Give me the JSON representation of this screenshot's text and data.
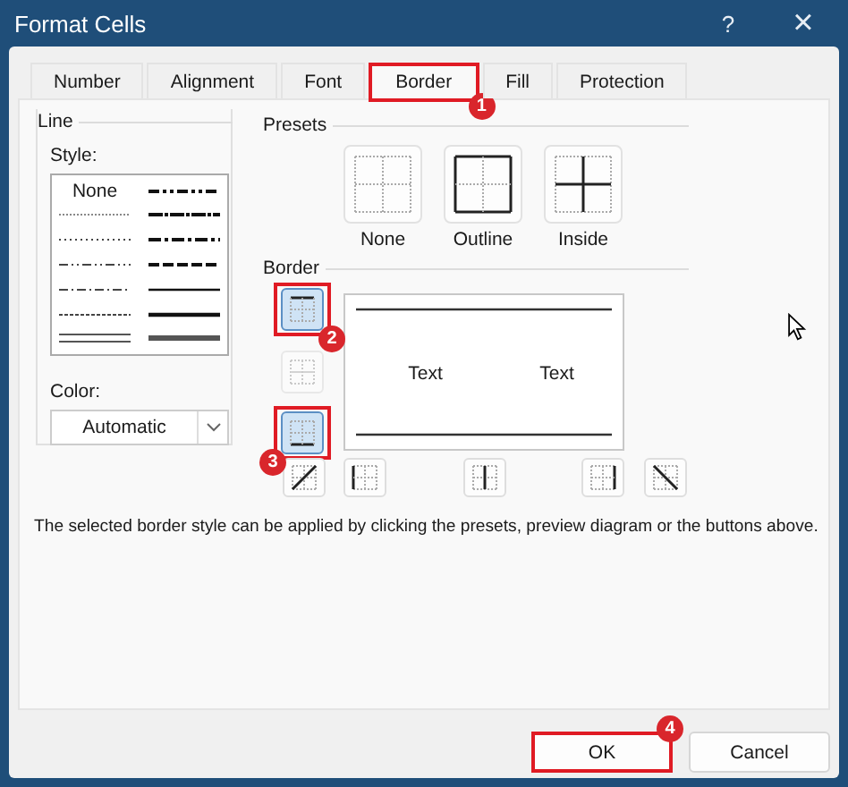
{
  "window": {
    "title": "Format Cells",
    "help": "?",
    "close": "×"
  },
  "tabs": [
    {
      "label": "Number",
      "selected": false
    },
    {
      "label": "Alignment",
      "selected": false
    },
    {
      "label": "Font",
      "selected": false
    },
    {
      "label": "Border",
      "selected": true,
      "callout": {
        "number": "1"
      }
    },
    {
      "label": "Fill",
      "selected": false
    },
    {
      "label": "Protection",
      "selected": false
    }
  ],
  "line": {
    "title": "Line",
    "style_label": "Style:",
    "styles": [
      {
        "kind": "none",
        "label": "None"
      },
      {
        "kind": "hair"
      },
      {
        "kind": "dotted"
      },
      {
        "kind": "dash-dot-dot"
      },
      {
        "kind": "dash-dot"
      },
      {
        "kind": "dashed-thin"
      },
      {
        "kind": "double"
      },
      {
        "kind": "medium-dash-dot-dot"
      },
      {
        "kind": "slant-dash-dot"
      },
      {
        "kind": "medium-dash-dot"
      },
      {
        "kind": "medium-dashed"
      },
      {
        "kind": "thin"
      },
      {
        "kind": "medium"
      },
      {
        "kind": "thick"
      }
    ],
    "color_label": "Color:",
    "color_choice": "Automatic"
  },
  "presets": {
    "title": "Presets",
    "items": [
      {
        "kind": "none",
        "label": "None"
      },
      {
        "kind": "outline",
        "label": "Outline"
      },
      {
        "kind": "inside",
        "label": "Inside"
      }
    ]
  },
  "border": {
    "title": "Border",
    "side_buttons": [
      {
        "kind": "top",
        "selected": true,
        "disabled": false,
        "callout": {
          "number": "2"
        }
      },
      {
        "kind": "horizontal",
        "selected": false,
        "disabled": true
      },
      {
        "kind": "bottom",
        "selected": true,
        "disabled": false,
        "callout": {
          "number": "3"
        }
      }
    ],
    "bottom_buttons": [
      {
        "kind": "diagonal-up",
        "selected": false,
        "disabled": false
      },
      {
        "kind": "left",
        "selected": false,
        "disabled": false
      },
      {
        "kind": "vertical",
        "selected": false,
        "disabled": false
      },
      {
        "kind": "right",
        "selected": false,
        "disabled": false
      },
      {
        "kind": "diagonal-down",
        "selected": false,
        "disabled": false
      }
    ],
    "preview_texts": [
      "Text",
      "Text"
    ]
  },
  "help_text": "The selected border style can be applied by clicking the presets, preview diagram or the buttons above.",
  "buttons": [
    {
      "label": "OK",
      "callout": {
        "number": "4"
      }
    },
    {
      "label": "Cancel"
    }
  ]
}
